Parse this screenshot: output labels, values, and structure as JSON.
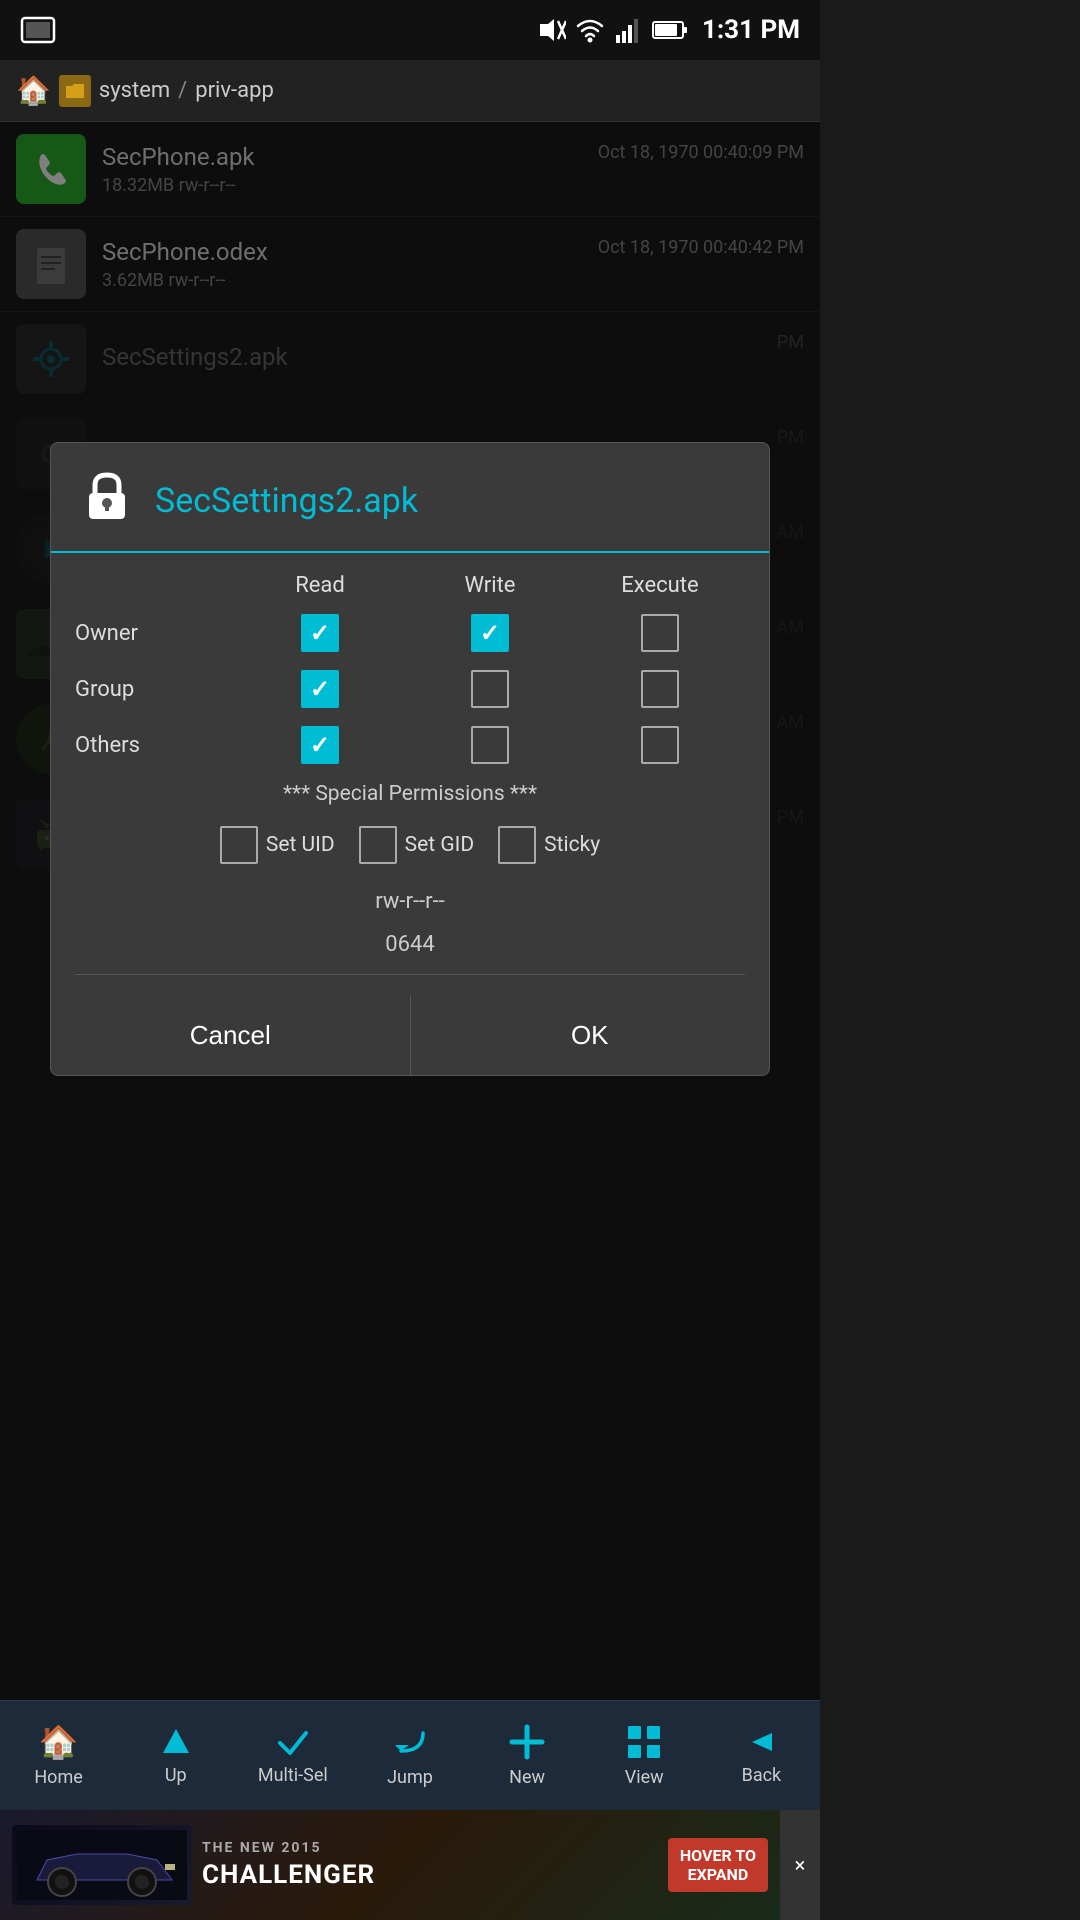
{
  "statusBar": {
    "time": "1:31 PM"
  },
  "breadcrumb": {
    "system": "system",
    "separator": "/",
    "privApp": "priv-app"
  },
  "fileList": [
    {
      "name": "SecPhone.apk",
      "size": "18.32MB",
      "perms": "rw-r--r--",
      "date": "Oct 18, 1970 00:40:09 PM",
      "iconType": "phone"
    },
    {
      "name": "SecPhone.odex",
      "size": "3.62MB",
      "perms": "rw-r--r--",
      "date": "Oct 18, 1970 00:40:42 PM",
      "iconType": "gray"
    },
    {
      "name": "SecSettings2.apk",
      "size": "",
      "perms": "",
      "date": "PM",
      "iconType": "gear"
    }
  ],
  "modal": {
    "title": "SecSettings2.apk",
    "permissions": {
      "headers": [
        "Read",
        "Write",
        "Execute"
      ],
      "rows": [
        {
          "label": "Owner",
          "read": true,
          "write": true,
          "execute": false
        },
        {
          "label": "Group",
          "read": true,
          "write": false,
          "execute": false
        },
        {
          "label": "Others",
          "read": true,
          "write": false,
          "execute": false
        }
      ]
    },
    "specialPermsTitle": "*** Special Permissions ***",
    "specialPerms": [
      {
        "label": "Set UID",
        "checked": false
      },
      {
        "label": "Set GID",
        "checked": false
      },
      {
        "label": "Sticky",
        "checked": false
      }
    ],
    "permString": "rw-r--r--",
    "permOctal": "0644",
    "cancelLabel": "Cancel",
    "okLabel": "OK"
  },
  "bottomNav": [
    {
      "label": "Home",
      "icon": "🏠"
    },
    {
      "label": "Up",
      "icon": "⬆"
    },
    {
      "label": "Multi-Sel",
      "icon": "✔"
    },
    {
      "label": "Jump",
      "icon": "↩"
    },
    {
      "label": "New",
      "icon": "✚"
    },
    {
      "label": "View",
      "icon": "⊞"
    },
    {
      "label": "Back",
      "icon": "◀"
    }
  ],
  "adBanner": {
    "mainText": "THE NEW 2015",
    "subText": "CHALLENGER",
    "ctaText": "HOVER TO\nEXPAND",
    "closeLabel": "×"
  },
  "colors": {
    "accent": "#00bcd4",
    "background": "#1a1a1a",
    "modalBg": "#3a3a3a",
    "navBg": "#1c2a3a",
    "adCtaBg": "#c0392b"
  }
}
